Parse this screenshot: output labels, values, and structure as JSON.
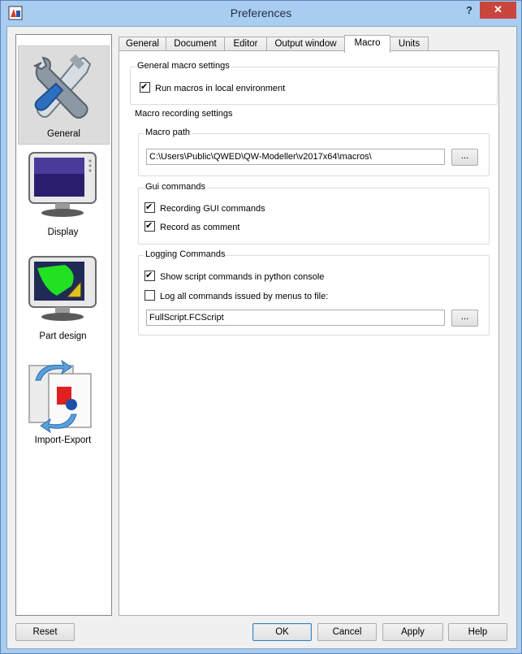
{
  "window": {
    "title": "Preferences",
    "help": "?",
    "close": "✕"
  },
  "categories": [
    {
      "label": "General",
      "icon": "tools-icon",
      "selected": true
    },
    {
      "label": "Display",
      "icon": "monitor-icon"
    },
    {
      "label": "Part design",
      "icon": "part-design-icon"
    },
    {
      "label": "Import-Export",
      "icon": "import-export-icon"
    }
  ],
  "tabs": [
    "General",
    "Document",
    "Editor",
    "Output window",
    "Macro",
    "Units"
  ],
  "active_tab": "Macro",
  "macro": {
    "general": {
      "title": "General macro settings",
      "run_local": {
        "label": "Run macros in local environment",
        "checked": true
      }
    },
    "recording_title": "Macro recording settings",
    "path": {
      "title": "Macro path",
      "value": "C:\\Users\\Public\\QWED\\QW-Modeller\\v2017x64\\macros\\",
      "browse": "..."
    },
    "gui": {
      "title": "Gui commands",
      "record_gui": {
        "label": "Recording GUI commands",
        "checked": true
      },
      "record_comment": {
        "label": "Record as comment",
        "checked": true
      }
    },
    "logging": {
      "title": "Logging Commands",
      "show_python": {
        "label": "Show script commands in python console",
        "checked": true
      },
      "log_all": {
        "label": "Log all commands issued by menus to file:",
        "checked": false
      },
      "file": "FullScript.FCScript",
      "browse": "..."
    }
  },
  "buttons": {
    "reset": "Reset",
    "ok": "OK",
    "cancel": "Cancel",
    "apply": "Apply",
    "help": "Help"
  }
}
